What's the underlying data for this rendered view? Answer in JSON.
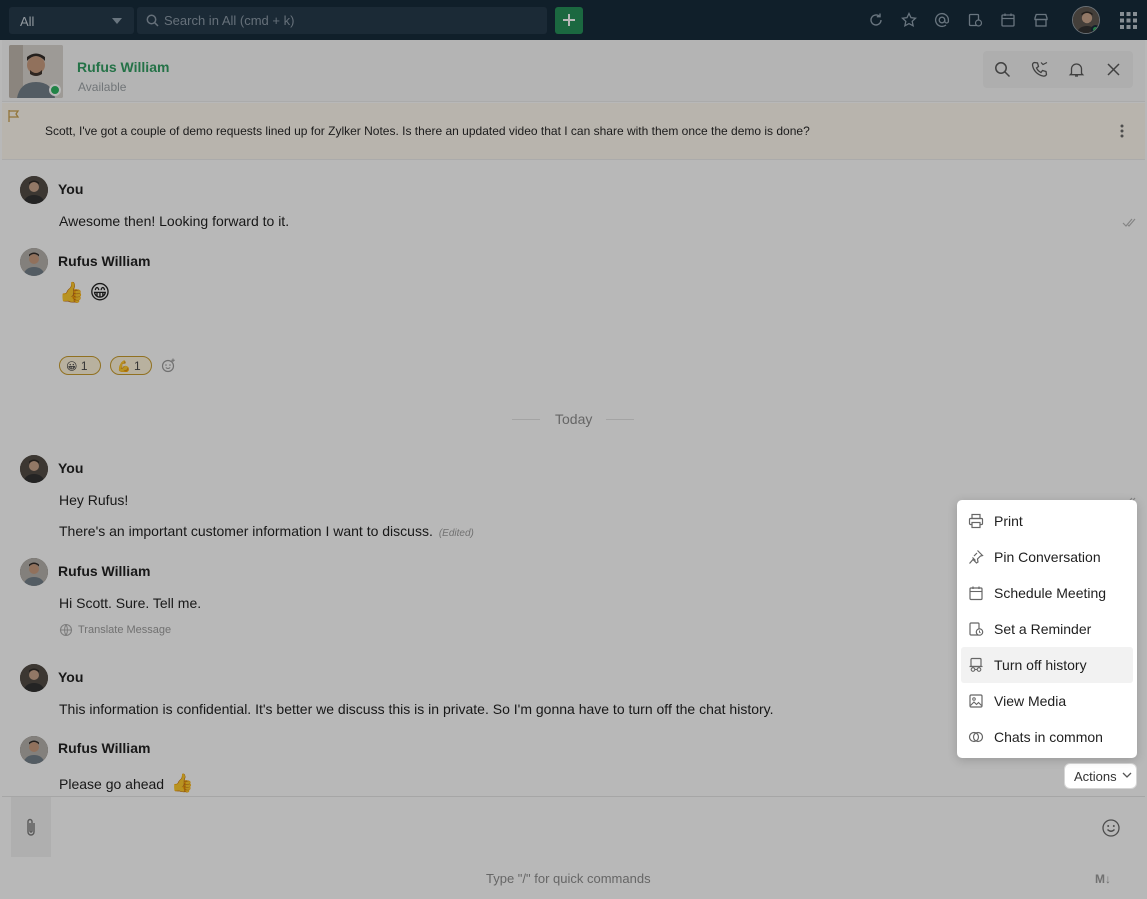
{
  "topbar": {
    "scope": "All",
    "search_placeholder": "Search in All (cmd + k)",
    "icons": [
      "refresh-icon",
      "star-icon",
      "mention-icon",
      "reminder-icon",
      "calendar-icon",
      "store-icon"
    ]
  },
  "chat": {
    "contact": {
      "name": "Rufus William",
      "status": "Available"
    },
    "header_actions": [
      "search-icon",
      "call-icon",
      "bell-icon",
      "close-icon"
    ],
    "pinned_message": "Scott, I've got a couple of demo requests lined up for Zylker Notes. Is there an updated video that I can share with them once the demo is done?",
    "date_divider": "Today",
    "messages": [
      {
        "sender": "You",
        "lines": [
          "Awesome then! Looking forward to it."
        ]
      },
      {
        "sender": "Rufus William",
        "emojis": "👍 😁",
        "reactions": [
          {
            "emoji": "😀",
            "count": "1"
          },
          {
            "emoji": "💪",
            "count": "1"
          }
        ]
      },
      {
        "sender": "You",
        "lines": [
          "Hey Rufus!",
          "There's an important customer information I want to discuss."
        ],
        "edited_label": "(Edited)"
      },
      {
        "sender": "Rufus William",
        "lines": [
          "Hi Scott. Sure. Tell me."
        ],
        "translate_label": "Translate Message"
      },
      {
        "sender": "You",
        "lines": [
          "This information is confidential. It's better we discuss this is in private. So I'm gonna have to turn off the chat history."
        ]
      },
      {
        "sender": "Rufus William",
        "lines": [
          "Please go ahead"
        ],
        "emoji": "👍"
      }
    ],
    "composer": {
      "hint": "Type \"/\" for quick commands",
      "markdown_label": "M↓"
    },
    "actions_button": "Actions",
    "actions_menu": [
      {
        "label": "Print",
        "icon": "printer-icon"
      },
      {
        "label": "Pin Conversation",
        "icon": "pin-icon"
      },
      {
        "label": "Schedule Meeting",
        "icon": "calendar-icon"
      },
      {
        "label": "Set a Reminder",
        "icon": "reminder-icon"
      },
      {
        "label": "Turn off history",
        "icon": "history-off-icon",
        "hovered": true
      },
      {
        "label": "View Media",
        "icon": "image-icon"
      },
      {
        "label": "Chats in common",
        "icon": "overlap-circles-icon"
      }
    ]
  }
}
